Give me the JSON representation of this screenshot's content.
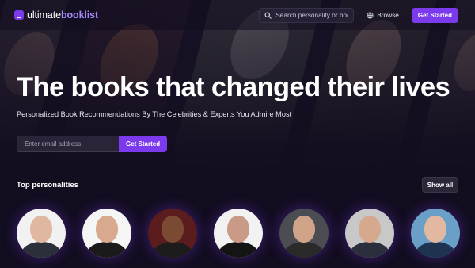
{
  "brand": {
    "name_part1": "ultimate",
    "name_part2": "booklist",
    "accent": "#7c3aed"
  },
  "nav": {
    "search_placeholder": "Search personality or book",
    "browse_label": "Browse",
    "browse_icon": "globe-icon",
    "search_icon": "search-icon",
    "cta_label": "Get Started"
  },
  "hero": {
    "title": "The books that changed their lives",
    "subtitle": "Personalized Book Recommendations By The Celebrities & Experts You Admire Most",
    "email_placeholder": "Enter email address",
    "cta_label": "Get Started"
  },
  "personalities": {
    "title": "Top personalities",
    "show_all_label": "Show all",
    "items": [
      {
        "bg": "#f1f1f1",
        "skin": "#e0b8a2",
        "body": "#2b2f3a"
      },
      {
        "bg": "#f5f5f5",
        "skin": "#d9a98f",
        "body": "#1a1a1a"
      },
      {
        "bg": "#5a1c1c",
        "skin": "#7b4a33",
        "body": "#1c1c1c"
      },
      {
        "bg": "#f2f2f2",
        "skin": "#c99a86",
        "body": "#141414"
      },
      {
        "bg": "#4b4d52",
        "skin": "#cfa488",
        "body": "#2a2a2a"
      },
      {
        "bg": "#c8c8c8",
        "skin": "#d6a98f",
        "body": "#2b2e3c"
      },
      {
        "bg": "#6aa0c8",
        "skin": "#e2b9a0",
        "body": "#1d3350"
      }
    ]
  }
}
